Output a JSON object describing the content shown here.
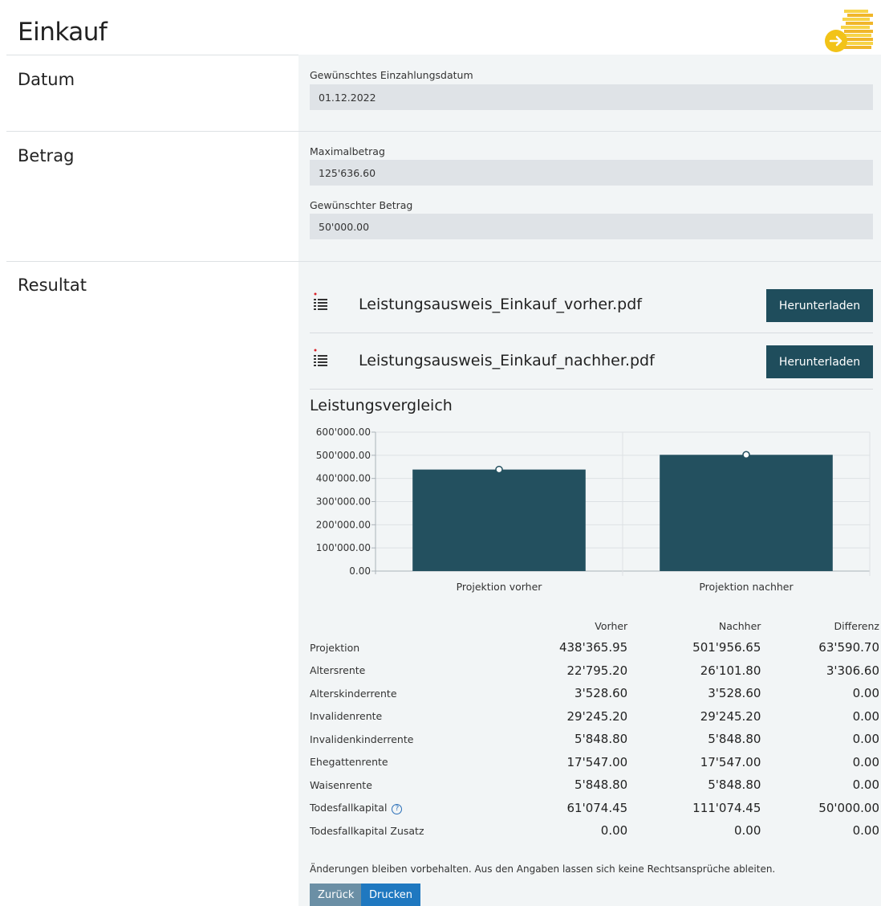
{
  "page_title": "Einkauf",
  "sections": {
    "datum": {
      "label": "Datum",
      "field_label": "Gewünschtes Einzahlungsdatum",
      "field_value": "01.12.2022"
    },
    "betrag": {
      "label": "Betrag",
      "max_label": "Maximalbetrag",
      "max_value": "125'636.60",
      "wanted_label": "Gewünschter Betrag",
      "wanted_value": "50'000.00"
    },
    "resultat": {
      "label": "Resultat",
      "files": [
        {
          "name": "Leistungsausweis_Einkauf_vorher.pdf",
          "button": "Herunterladen"
        },
        {
          "name": "Leistungsausweis_Einkauf_nachher.pdf",
          "button": "Herunterladen"
        }
      ],
      "chart_title": "Leistungsvergleich"
    }
  },
  "chart_data": {
    "type": "bar",
    "categories": [
      "Projektion vorher",
      "Projektion nachher"
    ],
    "values": [
      438365.95,
      501956.65
    ],
    "ylim": [
      0,
      600000
    ],
    "yticks": [
      "0.00",
      "100'000.00",
      "200'000.00",
      "300'000.00",
      "400'000.00",
      "500'000.00",
      "600'000.00"
    ],
    "bar_color": "#23505f",
    "grid": true
  },
  "table": {
    "headers": [
      "Vorher",
      "Nachher",
      "Differenz"
    ],
    "rows": [
      {
        "label": "Projektion",
        "vorher": "438'365.95",
        "nachher": "501'956.65",
        "differenz": "63'590.70"
      },
      {
        "label": "Altersrente",
        "vorher": "22'795.20",
        "nachher": "26'101.80",
        "differenz": "3'306.60"
      },
      {
        "label": "Alterskinderrente",
        "vorher": "3'528.60",
        "nachher": "3'528.60",
        "differenz": "0.00"
      },
      {
        "label": "Invalidenrente",
        "vorher": "29'245.20",
        "nachher": "29'245.20",
        "differenz": "0.00"
      },
      {
        "label": "Invalidenkinderrente",
        "vorher": "5'848.80",
        "nachher": "5'848.80",
        "differenz": "0.00"
      },
      {
        "label": "Ehegattenrente",
        "vorher": "17'547.00",
        "nachher": "17'547.00",
        "differenz": "0.00"
      },
      {
        "label": "Waisenrente",
        "vorher": "5'848.80",
        "nachher": "5'848.80",
        "differenz": "0.00"
      },
      {
        "label": "Todesfallkapital",
        "vorher": "61'074.45",
        "nachher": "111'074.45",
        "differenz": "50'000.00",
        "help": true
      },
      {
        "label": "Todesfallkapital Zusatz",
        "vorher": "0.00",
        "nachher": "0.00",
        "differenz": "0.00"
      }
    ]
  },
  "disclaimer": "Änderungen bleiben vorbehalten. Aus den Angaben lassen sich keine Rechtsansprüche ableiten.",
  "buttons": {
    "back": "Zurück",
    "print": "Drucken"
  },
  "colors": {
    "primary": "#1f4d5c",
    "print": "#1f78c0",
    "back": "#6b8fa5",
    "logo": "#f2c318"
  }
}
